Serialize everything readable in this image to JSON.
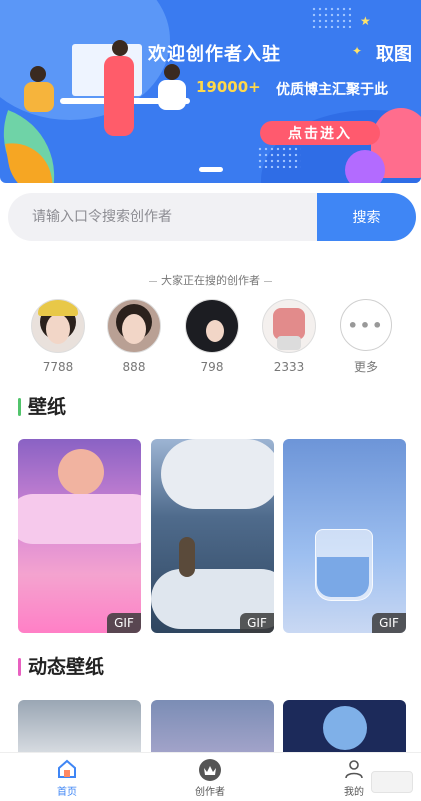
{
  "banner": {
    "title": "欢迎创作者入驻",
    "side_text": "取图",
    "count": "19000+",
    "subtitle": "优质博主汇聚于此",
    "cta": "点击进入"
  },
  "search": {
    "placeholder": "请输入口令搜索创作者",
    "button": "搜索"
  },
  "creators": {
    "hint": "大家正在搜的创作者",
    "items": [
      {
        "count": "7788",
        "avatar": "avatar-girl-cap"
      },
      {
        "count": "888",
        "avatar": "avatar-girl"
      },
      {
        "count": "798",
        "avatar": "avatar-dark"
      },
      {
        "count": "2333",
        "avatar": "avatar-robot"
      }
    ],
    "more_label": "更多"
  },
  "sections": {
    "wallpaper": {
      "title": "壁纸",
      "accent": "#52c46c",
      "items": [
        {
          "badge": "GIF",
          "subject": "pink moon clouds"
        },
        {
          "badge": "GIF",
          "subject": "cherry blossom boat"
        },
        {
          "badge": "GIF",
          "subject": "girl in glass"
        }
      ]
    },
    "live_wallpaper": {
      "title": "动态壁纸",
      "accent": "#e860c0"
    }
  },
  "tabbar": {
    "active_color": "#3f86f5",
    "tabs": [
      {
        "label": "首页",
        "icon": "home-icon"
      },
      {
        "label": "创作者",
        "icon": "crown-icon"
      },
      {
        "label": "我的",
        "icon": "user-icon"
      }
    ]
  }
}
